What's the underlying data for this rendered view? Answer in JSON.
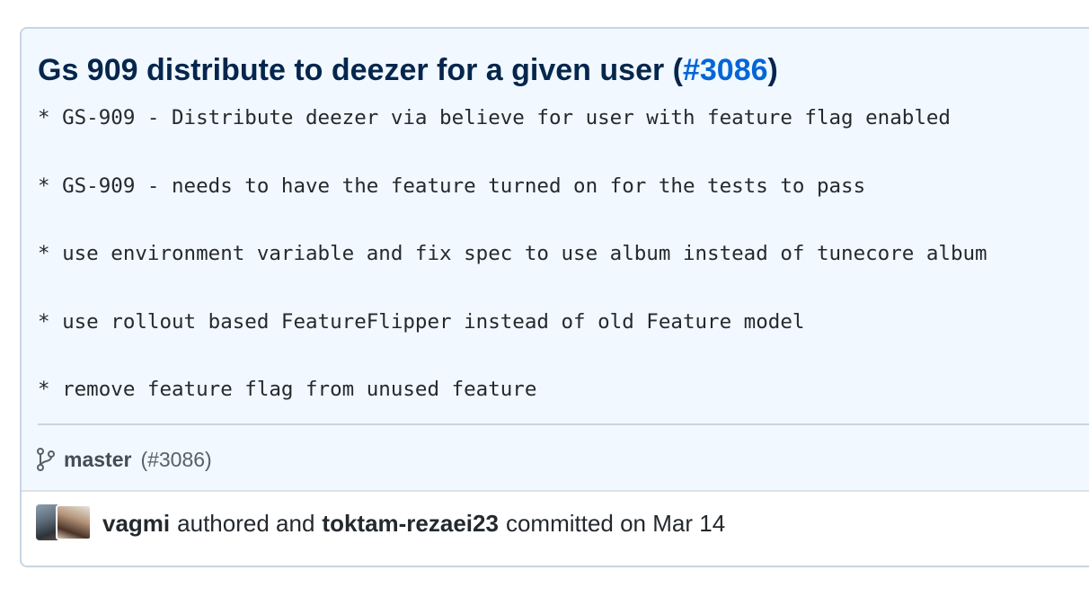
{
  "commit": {
    "title_prefix": "Gs 909 distribute to deezer for a given user (",
    "pr_link": "#3086",
    "title_suffix": ")",
    "description_lines": [
      "* GS-909 - Distribute deezer via believe for user with feature flag enabled",
      "* GS-909 - needs to have the feature turned on for the tests to pass",
      "* use environment variable and fix spec to use album instead of tunecore album",
      "* use rollout based FeatureFlipper instead of old Feature model",
      "* remove feature flag from unused feature"
    ],
    "branch": {
      "icon": "git-branch-icon",
      "name": "master",
      "pr_ref": "(#3086)"
    },
    "meta": {
      "author": "vagmi",
      "authored_text": "authored and",
      "committer": "toktam-rezaei23",
      "committed_text": "committed on Mar 14"
    }
  },
  "colors": {
    "title": "#05264c",
    "link": "#0366d6",
    "header_bg": "#f1f8ff",
    "border": "#c8d5e3"
  }
}
